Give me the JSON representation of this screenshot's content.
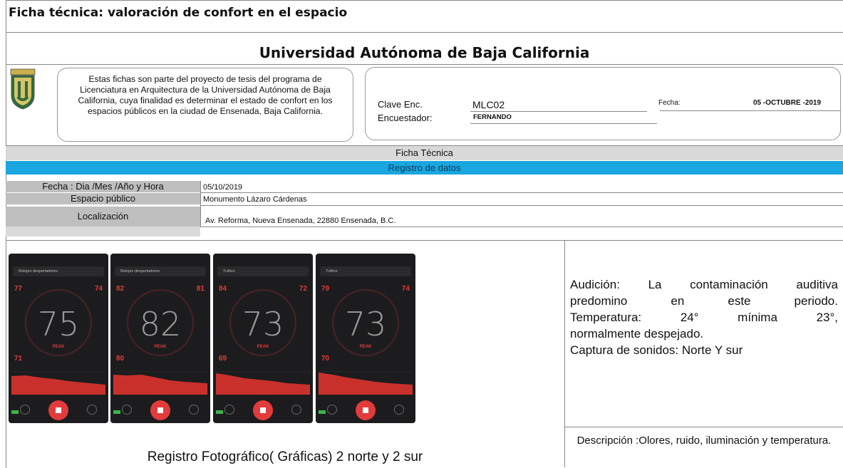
{
  "header": {
    "title": "Ficha técnica: valoración de confort en el espacio",
    "university": "Universidad Autónoma de Baja California"
  },
  "intro": {
    "text": "Estas fichas son parte del proyecto de tesis del programa de Licenciatura en Arquitectura de la Universidad Autónoma de Baja California,  cuya finalidad es determinar el estado de confort en los espacios públicos en la ciudad de Ensenada, Baja California."
  },
  "info": {
    "clave_label": "Clave Enc.",
    "clave_value": "MLC02",
    "encuestador_label": "Encuestador:",
    "encuestador_value": "FERNANDO",
    "fecha_label": "Fecha:",
    "fecha_value": "05 -OCTUBRE  -2019"
  },
  "sections": {
    "ficha": "Ficha Técnica",
    "registro": "Registro de datos"
  },
  "rows": [
    {
      "label": "Fecha : Dia /Mes /Año  y Hora",
      "value": "05/10/2019"
    },
    {
      "label": "Espacio público",
      "value": "Monumento Lázaro Cárdenas"
    },
    {
      "label": "Localización",
      "value": "Av. Reforma, Nueva Ensenada, 22880 Ensenada, B.C."
    }
  ],
  "phones": [
    {
      "tab": "Relojes despertadores",
      "peak": "75",
      "tl": "77",
      "tr": "74",
      "bl": "71"
    },
    {
      "tab": "Relojes despertadores",
      "peak": "82",
      "tl": "82",
      "tr": "81",
      "bl": "80"
    },
    {
      "tab": "Tráfico",
      "peak": "73",
      "tl": "84",
      "tr": "72",
      "bl": "69"
    },
    {
      "tab": "Tráfico",
      "peak": "73",
      "tl": "79",
      "tr": "74",
      "bl": "70"
    }
  ],
  "phone_peak_label": "PEAK",
  "observations": {
    "line1": "Audición: La contaminación auditiva",
    "line2": "predomino en este periodo.",
    "line3": "Temperatura: 24° mínima 23°,",
    "line4": "normalmente despejado.",
    "line5": "Captura de sonidos: Norte Y sur"
  },
  "description": "Descripción :Olores, ruido, iluminación y temperatura.",
  "photo_caption": "Registro Fotográfico( Gráficas) 2 norte y 2 sur",
  "colors": {
    "blue_band": "#1aa6df",
    "gray_band": "#d9d9d9",
    "label_gray": "#bfbfbf",
    "meter_red": "#e23b3b"
  }
}
